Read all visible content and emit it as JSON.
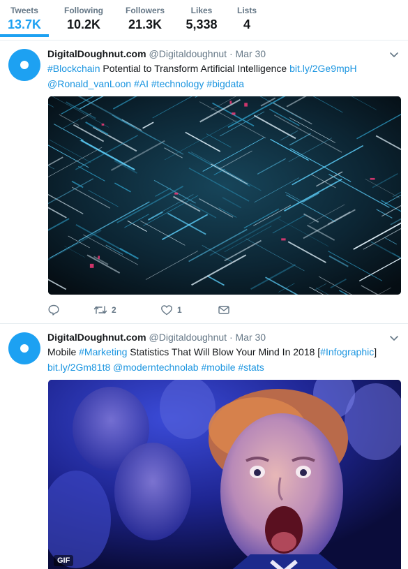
{
  "profile_nav": {
    "stats": [
      {
        "label": "Tweets",
        "value": "13.7K"
      },
      {
        "label": "Following",
        "value": "10.2K"
      },
      {
        "label": "Followers",
        "value": "21.3K"
      },
      {
        "label": "Likes",
        "value": "5,338"
      },
      {
        "label": "Lists",
        "value": "4"
      }
    ],
    "active_stat": "Tweets"
  },
  "tweets": [
    {
      "author_name": "DigitalDoughnut.com",
      "handle": "@Digitaldoughnut",
      "separator": "·",
      "time": "Mar 30",
      "lines": [
        [
          {
            "t": "#Blockchain",
            "link": true
          },
          {
            "t": " Potential to Transform Artificial Intelligence ",
            "link": false
          },
          {
            "t": "bit.ly/2Ge9mpH",
            "link": true
          }
        ],
        [
          {
            "t": "@Ronald_vanLoon",
            "link": true
          },
          {
            "t": "  ",
            "link": false
          },
          {
            "t": "#AI",
            "link": true
          },
          {
            "t": " ",
            "link": false
          },
          {
            "t": "#technology",
            "link": true
          },
          {
            "t": " ",
            "link": false
          },
          {
            "t": "#bigdata",
            "link": true
          }
        ]
      ],
      "media": {
        "kind": "image",
        "icon": "blockchain-abstract-image"
      },
      "actions": {
        "reply_count": "",
        "retweet_count": "2",
        "like_count": "1"
      }
    },
    {
      "author_name": "DigitalDoughnut.com",
      "handle": "@Digitaldoughnut",
      "separator": "·",
      "time": "Mar 30",
      "lines": [
        [
          {
            "t": "Mobile ",
            "link": false
          },
          {
            "t": "#Marketing",
            "link": true
          },
          {
            "t": " Statistics That Will Blow Your Mind In 2018 [",
            "link": false
          },
          {
            "t": "#Infographic",
            "link": true
          },
          {
            "t": "]",
            "link": false
          }
        ],
        [
          {
            "t": "bit.ly/2Gm81t8",
            "link": true
          },
          {
            "t": " ",
            "link": false
          },
          {
            "t": "@moderntechnolab",
            "link": true
          },
          {
            "t": " ",
            "link": false
          },
          {
            "t": "#mobile",
            "link": true
          },
          {
            "t": " ",
            "link": false
          },
          {
            "t": "#stats",
            "link": true
          }
        ]
      ],
      "media": {
        "kind": "gif",
        "badge": "GIF",
        "icon": "surprised-fan-gif"
      }
    }
  ],
  "colors": {
    "accent": "#1da1f2",
    "link": "#1b95e0",
    "muted": "#657786",
    "text": "#14171a",
    "divider": "#e6ecf0"
  }
}
